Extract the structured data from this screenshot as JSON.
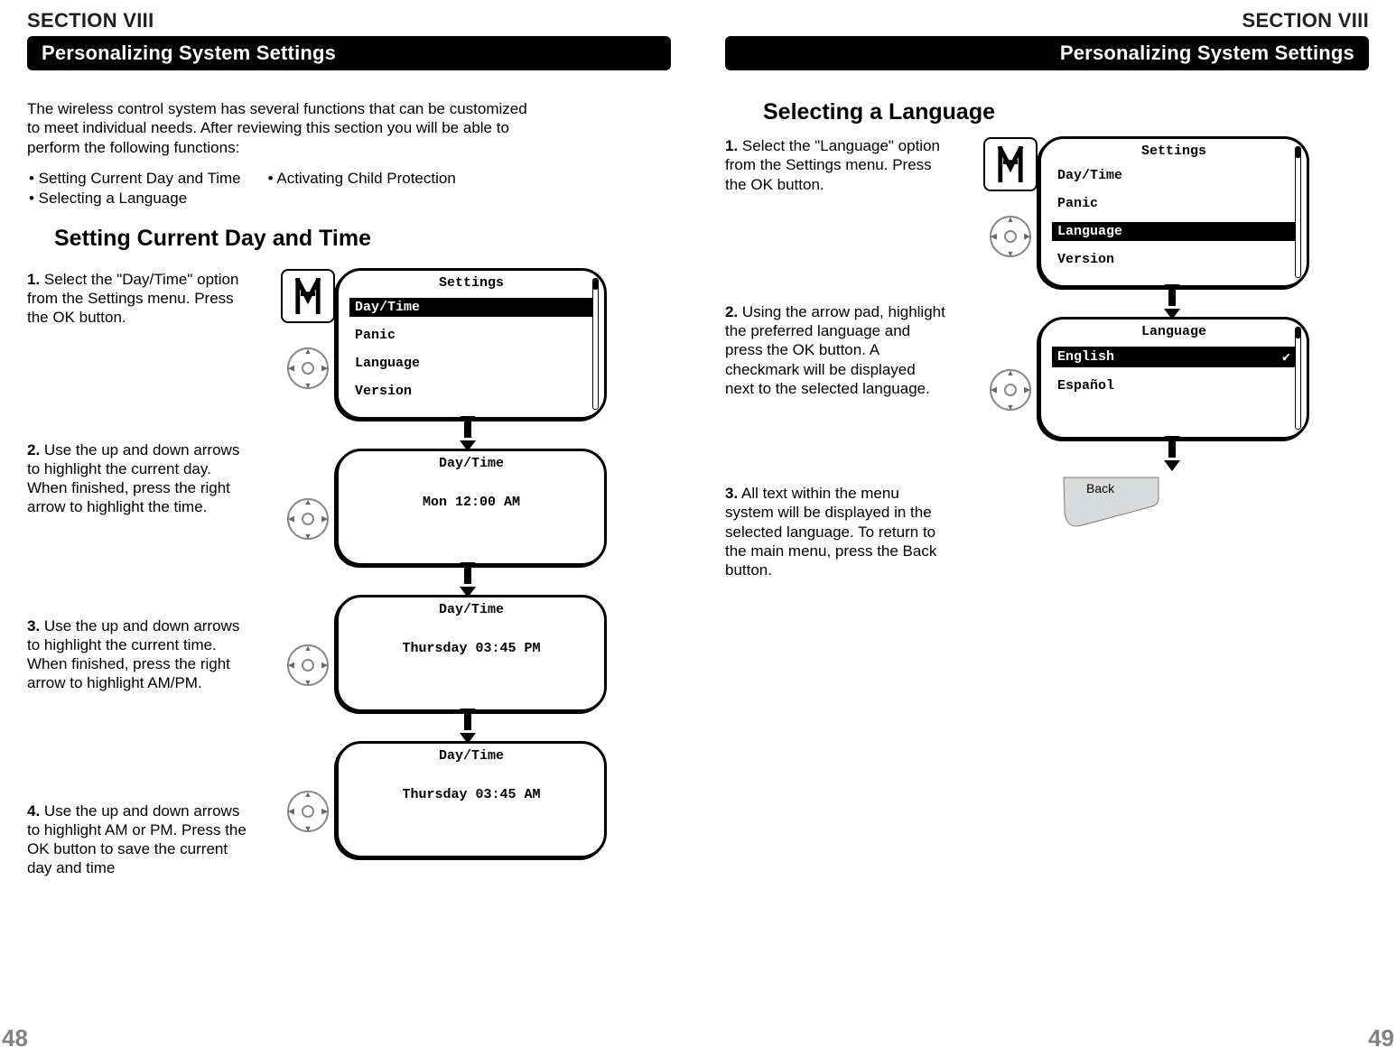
{
  "left": {
    "section": "SECTION VIII",
    "bar": "Personalizing System Settings",
    "pageNum": "48",
    "intro": "The wireless control system has several functions that can be customized to meet individual needs. After reviewing this section you will be able to perform the following functions:",
    "b1": "• Setting Current Day and Time",
    "b2": "• Activating Child Protection",
    "b3": "• Selecting a Language",
    "heading": "Setting Current Day and Time",
    "step1": "Select the \"Day/Time\" option from the Settings menu. Press the OK button.",
    "step2": "Use the up and down arrows to highlight the current day. When finished, press the right arrow to highlight the time.",
    "step3": "Use the up and down arrows to highlight the current time. When finished, press the right arrow to highlight AM/PM.",
    "step4": "Use the up and down arrows to highlight AM or PM. Press the OK button to save the current day and time",
    "screen1_title": "Settings",
    "m1": "Day/Time",
    "m2": "Panic",
    "m3": "Language",
    "m4": "Version",
    "screen2_title": "Day/Time",
    "s2_day": "Mon",
    "s2_time": "12:00 AM",
    "screen3_title": "Day/Time",
    "s3_day": "Thursday",
    "s3_time": "03:45 PM",
    "screen4_title": "Day/Time",
    "s4_day": "Thursday",
    "s4_time": "03:45 AM"
  },
  "right": {
    "section": "SECTION VIII",
    "bar": "Personalizing System Settings",
    "pageNum": "49",
    "heading": "Selecting a Language",
    "step1": "Select the \"Language\" option from the Settings menu. Press the OK button.",
    "step2": "Using the arrow pad, highlight the preferred language and press the OK button. A checkmark will be displayed next to the selected language.",
    "step3": "All text within the menu system will be displayed in the selected language. To return to the main menu, press the Back button.",
    "screen1_title": "Settings",
    "m1": "Day/Time",
    "m2": "Panic",
    "m3": "Language",
    "m4": "Version",
    "screen2_title": "Language",
    "lang1": "English",
    "lang2": "Español",
    "back": "Back"
  }
}
